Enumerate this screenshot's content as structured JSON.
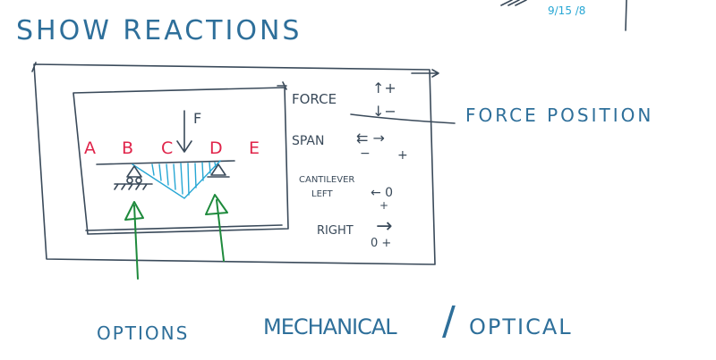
{
  "title": "SHOW REACTIONS",
  "corner_note": "9/15 /8",
  "controls": {
    "force_label": "FORCE",
    "force_up": "↑+",
    "force_down": "↓−",
    "force_position_label": "FORCE POSITION",
    "span_label": "SPAN",
    "span_arrows": "⇇ →",
    "span_minus": "−",
    "span_plus": "+",
    "cantilever_label": "CANTILEVER",
    "cantilever_left_label": "LEFT",
    "cantilever_left_arrow": "← 0",
    "cantilever_left_plus": "+",
    "right_label": "RIGHT",
    "right_arrow": "→",
    "right_values": "0 +"
  },
  "beam": {
    "points": [
      "A",
      "B",
      "C",
      "D",
      "E"
    ],
    "force_label": "F"
  },
  "footer": {
    "options_label": "OPTIONS",
    "mode_mechanical": "MECHANICAL",
    "mode_separator": "/",
    "mode_optical": "OPTICAL"
  },
  "colors": {
    "ink_blue": "#2e6f9a",
    "ink_dark": "#3a4a5a",
    "point_red": "#e0244a",
    "hatch_cyan": "#27a7d4",
    "reaction_green": "#1e8a3c"
  }
}
